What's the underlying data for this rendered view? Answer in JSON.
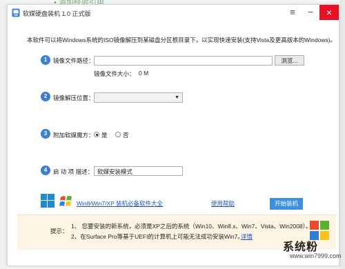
{
  "background": {
    "link_text": "• 添加经验引用"
  },
  "window": {
    "title": "软媒硬盘装机 1.0 正式版",
    "intro": "本软件可以将Windows系统的ISO镜像解压到某磁盘分区根目录下，以实现快速安装(支持Vista及更高版本的Windows)。"
  },
  "steps": [
    {
      "number": "1",
      "label": "镜像文件路径：",
      "input_value": "",
      "browse_label": "浏览...",
      "size_label": "镜像文件大小：",
      "size_value": "0 M"
    },
    {
      "number": "2",
      "label": "镜像解压位置：",
      "selected": ""
    },
    {
      "number": "3",
      "label": "附加软媒魔方：",
      "yes_label": "是",
      "no_label": "否",
      "selected": "是"
    },
    {
      "number": "4",
      "label": "启 动 项 描述：",
      "input_value": "软媒安装模式"
    }
  ],
  "footer": {
    "promo_link": "Win8/Win7/XP 装机必备软件大全",
    "help_link": "使用帮助",
    "start_button": "开始装机"
  },
  "tips": {
    "label": "提示：",
    "line1": "1、 您要安装的新系统，必须是XP之后的系统（Win10、Win8.x、Win7、Vista、Win2008）。",
    "line2": "2、在Surface Pro等基于UEFI的计算机上可能无法成功安装Win7。",
    "details_link": "详情"
  },
  "watermark": {
    "text": "系统粉",
    "url": "www.win7999.com"
  },
  "colors": {
    "accent": "#3d7fd1",
    "close": "#e81123",
    "link": "#1d55b8",
    "tip_bg": "#fdf4e4"
  }
}
